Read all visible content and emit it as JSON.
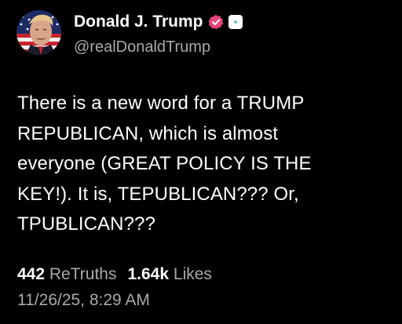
{
  "author": {
    "display_name": "Donald J. Trump",
    "handle": "@realDonaldTrump",
    "avatar_icon": "user-avatar-flag",
    "verified_icon": "verified-badge-icon",
    "verified_color": "#e8457a",
    "affiliation_icon": "affiliation-badge-icon"
  },
  "post": {
    "text": "There is a new word for a TRUMP\nREPUBLICAN, which is almost\neveryone (GREAT POLICY IS THE\nKEY!). It is, TEPUBLICAN??? Or,\nTPUBLICAN???"
  },
  "stats": {
    "retruths_count": "442",
    "retruths_label": "ReTruths",
    "likes_count": "1.64k",
    "likes_label": "Likes"
  },
  "timestamp": "11/26/25, 8:29 AM",
  "colors": {
    "background": "#000000",
    "primary_text": "#ffffff",
    "secondary_text": "#a9a9ad"
  }
}
